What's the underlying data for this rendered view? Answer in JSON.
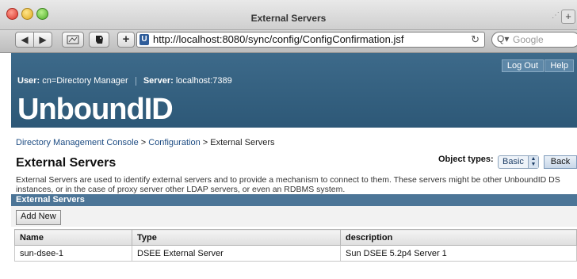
{
  "window": {
    "title": "External Servers",
    "new_tab_glyph": "+"
  },
  "toolbar": {
    "back_glyph": "◀",
    "forward_glyph": "▶",
    "plus_glyph": "+",
    "url": "http://localhost:8080/sync/config/ConfigConfirmation.jsf",
    "reload_glyph": "↻",
    "search_placeholder": "Google"
  },
  "header": {
    "logout_label": "Log Out",
    "help_label": "Help",
    "user_label": "User:",
    "user_value": "cn=Directory Manager",
    "server_label": "Server:",
    "server_value": "localhost:7389",
    "logo_text": "UnboundID"
  },
  "breadcrumb": {
    "items": [
      "Directory Management Console",
      "Configuration",
      "External Servers"
    ],
    "separator": ">"
  },
  "page": {
    "title": "External Servers",
    "object_types_label": "Object types:",
    "object_types_value": "Basic",
    "back_label": "Back",
    "description": "External Servers are used to identify external servers and to provide a mechanism to connect to them. These servers might be other UnboundID DS instances, or in the case of proxy server other LDAP servers, or even an RDBMS system."
  },
  "section": {
    "title": "External Servers",
    "add_button_label": "Add New"
  },
  "table": {
    "columns": [
      "Name",
      "Type",
      "description"
    ],
    "rows": [
      [
        "sun-dsee-1",
        "DSEE External Server",
        "Sun DSEE 5.2p4 Server 1"
      ]
    ]
  },
  "colors": {
    "header_bg": "#35617f",
    "section_bar": "#4c7597",
    "link": "#1c4b82"
  }
}
